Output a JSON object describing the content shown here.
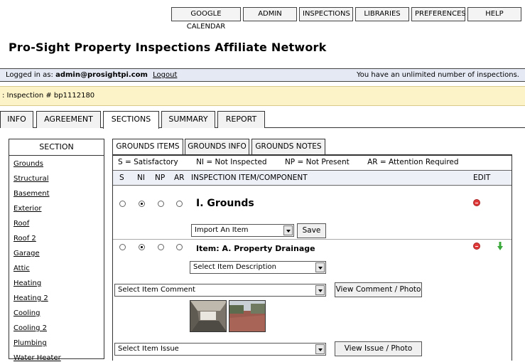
{
  "topnav": [
    "GOOGLE CALENDAR",
    "ADMIN",
    "INSPECTIONS",
    "LIBRARIES",
    "PREFERENCES",
    "HELP"
  ],
  "header": {
    "title": "Pro-Sight Property Inspections Affiliate Network"
  },
  "login": {
    "prefix": "Logged in as:",
    "user": "admin@prosightpi.com",
    "logout": "Logout",
    "status": "You have an unlimited number of inspections."
  },
  "inspection": {
    "label": ": Inspection # bp1112180"
  },
  "main_tabs": [
    "INFO",
    "AGREEMENT",
    "SECTIONS",
    "SUMMARY",
    "REPORT"
  ],
  "sidebar": {
    "header": "SECTION",
    "items": [
      "Grounds",
      "Structural",
      "Basement",
      "Exterior",
      "Roof",
      "Roof 2",
      "Garage",
      "Attic",
      "Heating",
      "Heating 2",
      "Cooling",
      "Cooling 2",
      "Plumbing",
      "Water Heater"
    ]
  },
  "sub_tabs": [
    "GROUNDS ITEMS",
    "GROUNDS INFO",
    "GROUNDS NOTES"
  ],
  "legend": [
    "S = Satisfactory",
    "NI = Not Inspected",
    "NP = Not Present",
    "AR = Attention Required"
  ],
  "columns": {
    "s": "S",
    "ni": "NI",
    "np": "NP",
    "ar": "AR",
    "component": "INSPECTION ITEM/COMPONENT",
    "edit": "EDIT"
  },
  "section_row": {
    "name": "I. Grounds",
    "rating": "NI",
    "import_select": "Import An Item",
    "save_label": "Save"
  },
  "item_row": {
    "name": "Item: A. Property Drainage",
    "rating": "NI",
    "description_select": "Select Item Description",
    "comment_select": "Select Item Comment",
    "view_comment_label": "View Comment / Photo",
    "issue_select": "Select Item Issue",
    "view_issue_label": "View Issue / Photo"
  },
  "colors": {
    "login_bar": "#e4e9f4",
    "inspection_bar": "#fdf3c8",
    "delete_icon": "#e03a3a",
    "move_down_icon": "#3aa83a"
  },
  "icons": [
    "delete-icon",
    "move-down-icon"
  ]
}
